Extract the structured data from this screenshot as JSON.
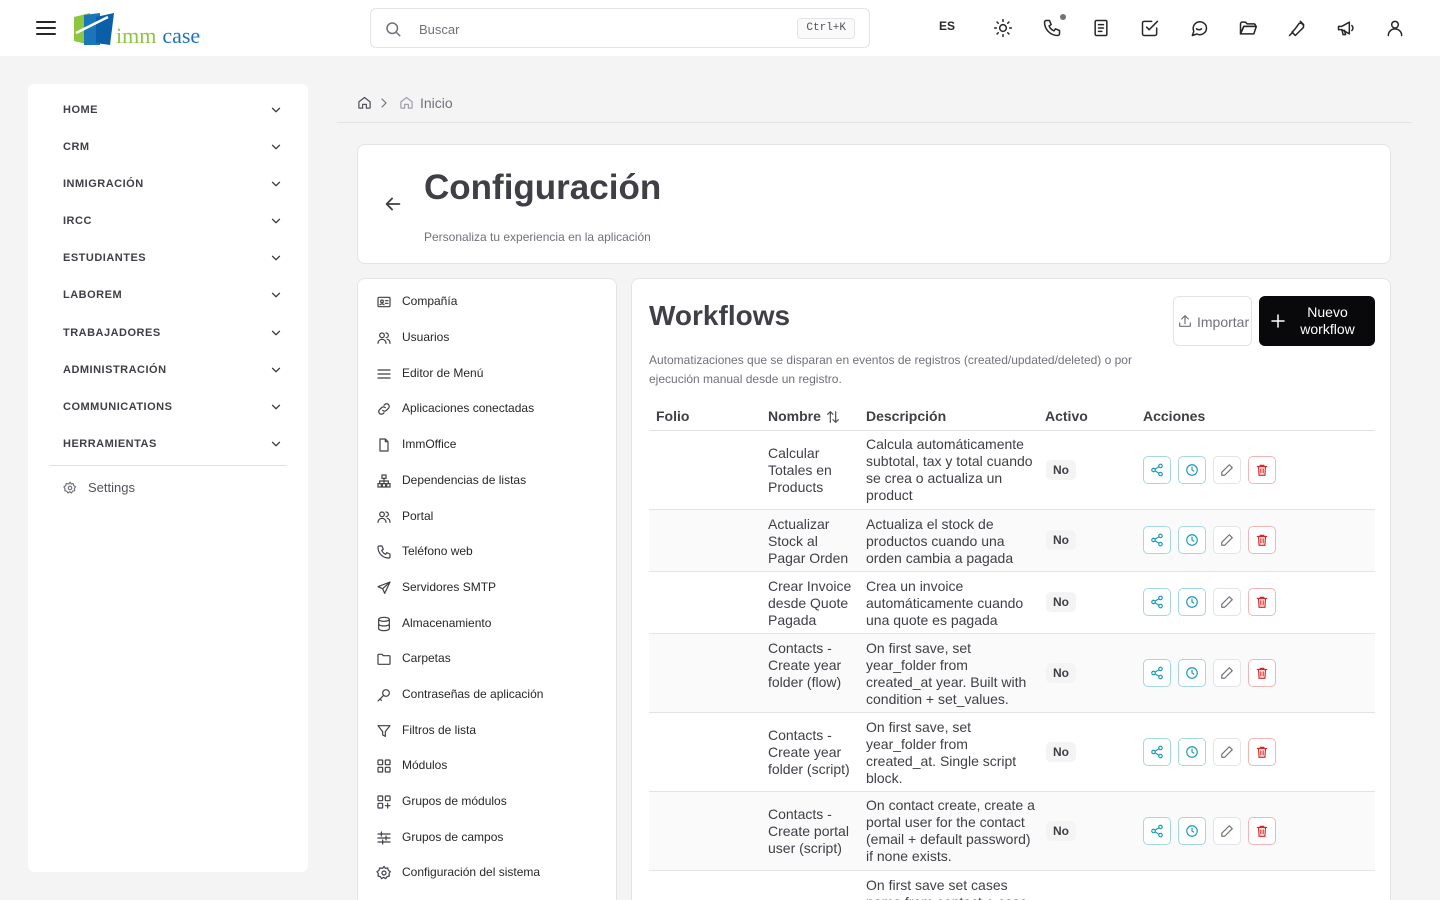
{
  "topbar": {
    "logo": {
      "word1": "imm",
      "word2": "case"
    },
    "search": {
      "placeholder": "Buscar",
      "shortcut": "Ctrl+K"
    },
    "language": "ES",
    "icons": [
      "theme-sun-icon",
      "phone-icon",
      "notes-icon",
      "tasks-check-icon",
      "chat-icon",
      "folder-open-icon",
      "tools-icon",
      "megaphone-icon",
      "user-icon"
    ]
  },
  "sidebar": {
    "items": [
      {
        "label": "HOME"
      },
      {
        "label": "CRM"
      },
      {
        "label": "INMIGRACIÓN"
      },
      {
        "label": "IRCC"
      },
      {
        "label": "ESTUDIANTES"
      },
      {
        "label": "LABOREM"
      },
      {
        "label": "TRABAJADORES"
      },
      {
        "label": "ADMINISTRACIÓN"
      },
      {
        "label": "COMMUNICATIONS"
      },
      {
        "label": "HERRAMIENTAS"
      }
    ],
    "settings_label": "Settings"
  },
  "breadcrumb": {
    "current": "Inicio"
  },
  "header": {
    "title": "Configuración",
    "subtitle": "Personaliza tu experiencia en la aplicación"
  },
  "settings_menu": {
    "items": [
      {
        "label": "Compañía",
        "icon": "id-card-icon"
      },
      {
        "label": "Usuarios",
        "icon": "users-icon"
      },
      {
        "label": "Editor de Menú",
        "icon": "menu-lines-icon"
      },
      {
        "label": "Aplicaciones conectadas",
        "icon": "link-icon"
      },
      {
        "label": "ImmOffice",
        "icon": "file-icon"
      },
      {
        "label": "Dependencias de listas",
        "icon": "hierarchy-icon"
      },
      {
        "label": "Portal",
        "icon": "users-icon"
      },
      {
        "label": "Teléfono web",
        "icon": "phone-icon"
      },
      {
        "label": "Servidores SMTP",
        "icon": "send-icon"
      },
      {
        "label": "Almacenamiento",
        "icon": "database-icon"
      },
      {
        "label": "Carpetas",
        "icon": "folder-icon"
      },
      {
        "label": "Contraseñas de aplicación",
        "icon": "key-icon"
      },
      {
        "label": "Filtros de lista",
        "icon": "filter-icon"
      },
      {
        "label": "Módulos",
        "icon": "grid-icon"
      },
      {
        "label": "Grupos de módulos",
        "icon": "grid-plus-icon"
      },
      {
        "label": "Grupos de campos",
        "icon": "sliders-icon"
      },
      {
        "label": "Configuración del sistema",
        "icon": "gear-icon"
      }
    ]
  },
  "workflows": {
    "title": "Workflows",
    "description": "Automatizaciones que se disparan en eventos de registros (created/updated/deleted) o por ejecución manual desde un registro.",
    "import_label": "Importar",
    "new_label": "Nuevo workflow",
    "columns": {
      "folio": "Folio",
      "name": "Nombre",
      "description": "Descripción",
      "active": "Activo",
      "actions": "Acciones"
    },
    "rows": [
      {
        "folio": "",
        "name": "Calcular Totales en Products",
        "description": "Calcula automáticamente subtotal, tax y total cuando se crea o actualiza un product",
        "active": "No"
      },
      {
        "folio": "",
        "name": "Actualizar Stock al Pagar Orden",
        "description": "Actualiza el stock de productos cuando una orden cambia a pagada",
        "active": "No"
      },
      {
        "folio": "",
        "name": "Crear Invoice desde Quote Pagada",
        "description": "Crea un invoice automáticamente cuando una quote es pagada",
        "active": "No"
      },
      {
        "folio": "",
        "name": "Contacts - Create year folder (flow)",
        "description": "On first save, set year_folder from created_at year. Built with condition + set_values.",
        "active": "No"
      },
      {
        "folio": "",
        "name": "Contacts - Create year folder (script)",
        "description": "On first save, set year_folder from created_at. Single script block.",
        "active": "No"
      },
      {
        "folio": "",
        "name": "Contacts - Create portal user (script)",
        "description": "On contact create, create a portal user for the contact (email + default password) if none exists.",
        "active": "No"
      },
      {
        "folio": "",
        "name": "",
        "description": "On first save set cases name from contact + case",
        "active": ""
      }
    ]
  },
  "colors": {
    "accent_teal": "#1a9bb8",
    "danger": "#dc2626",
    "primary_button": "#09090b"
  }
}
